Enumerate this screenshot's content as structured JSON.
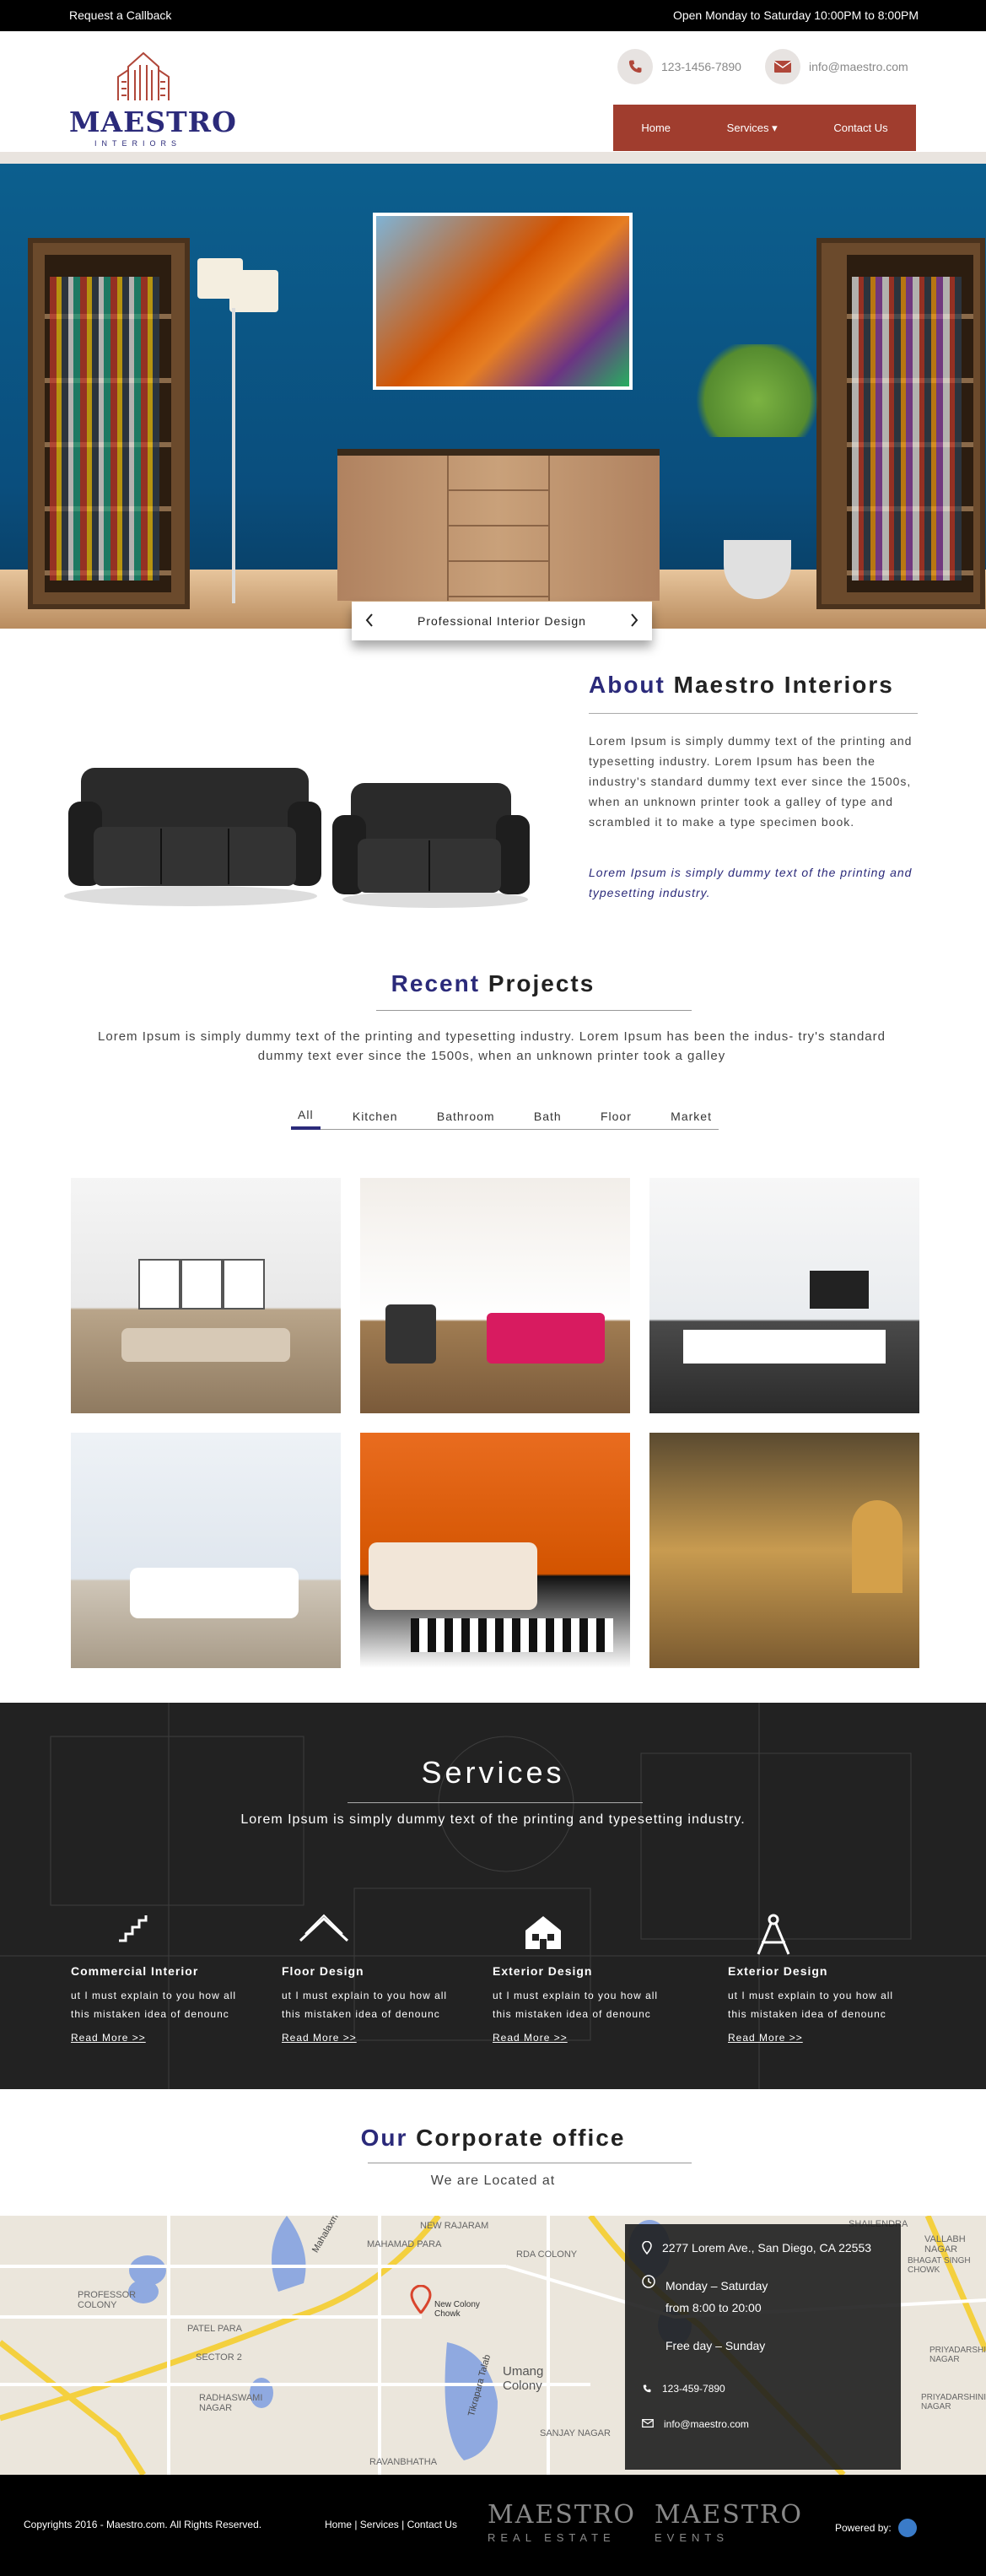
{
  "topbar": {
    "callback": "Request a Callback",
    "hours": "Open Monday to Saturday 10:00PM to 8:00PM"
  },
  "brand": {
    "name": "MAESTRO",
    "tagline": "INTERIORS"
  },
  "contact": {
    "phone": "123-1456-7890",
    "email": "info@maestro.com"
  },
  "nav": [
    "Home",
    "Services ▾",
    "Contact Us"
  ],
  "hero": {
    "caption": "Professional Interior Design"
  },
  "about": {
    "title_hl": "About",
    "title_rest": " Maestro Interiors",
    "text": "Lorem Ipsum is simply dummy text of the printing and typesetting industry. Lorem Ipsum has been the industry's standard dummy text ever since the 1500s, when an unknown printer took a galley of type and scrambled it to make a type specimen book.",
    "italic": "Lorem Ipsum is simply dummy text of the printing and typesetting industry."
  },
  "projects": {
    "title_hl": "Recent",
    "title_rest": " Projects",
    "desc": "Lorem Ipsum is simply dummy text of the printing and typesetting industry. Lorem Ipsum has been the indus- try's standard dummy text ever since the 1500s, when an unknown printer took a galley",
    "filters": [
      "All",
      "Kitchen",
      "Bathroom",
      "Bath",
      "Floor",
      "Market"
    ]
  },
  "services": {
    "title": "Services",
    "desc": "Lorem Ipsum is simply dummy text of the printing and typesetting industry.",
    "items": [
      {
        "title": "Commercial Interior",
        "text": "ut I must explain to you how all this mistaken idea of denounc",
        "link": "Read More >>"
      },
      {
        "title": "Floor Design",
        "text": "ut I must explain to you how all this mistaken idea of denounc",
        "link": "Read More >>"
      },
      {
        "title": "Exterior Design",
        "text": "ut I must explain to you how all this mistaken idea of denounc",
        "link": "Read More >>"
      },
      {
        "title": "Exterior Design",
        "text": "ut I must explain to you how all this mistaken idea of denounc",
        "link": "Read More >>"
      }
    ]
  },
  "office": {
    "title_hl": "Our",
    "title_rest": " Corporate office",
    "sub": "We are Located at",
    "address": "2277 Lorem Ave., San Diego, CA 22553",
    "days": "Monday – Saturday",
    "hours": "from 8:00 to 20:00",
    "free": "Free day – Sunday",
    "phone": "123-459-7890",
    "email": "info@maestro.com"
  },
  "map": {
    "labels": [
      "Mahalaxmi Talab",
      "MAHAMAD PARA",
      "NEW RAJARAM",
      "RDA COLONY",
      "PROFESSOR COLONY",
      "PATEL PARA",
      "SECTOR 2",
      "RADHASWAMI NAGAR",
      "RAVANBHATHA",
      "New Colony Chowk",
      "Umang Colony",
      "Tikrapara Talab",
      "SANJAY NAGAR",
      "BHAGAT SINGH CHOWK",
      "VALLABH NAGAR",
      "PRIYADARSHINI NAGAR",
      "PRIYADARSHINI NAGAR",
      "SHAILENDRA"
    ]
  },
  "footer": {
    "copy": "Copyrights 2016 - Maestro.com. All Rights Reserved.",
    "links": "Home | Services | Contact Us",
    "brand1": "MAESTRO",
    "brand1_sub": "REAL ESTATE",
    "brand2": "MAESTRO",
    "brand2_sub": "EVENTS",
    "powered": "Powered by:"
  }
}
